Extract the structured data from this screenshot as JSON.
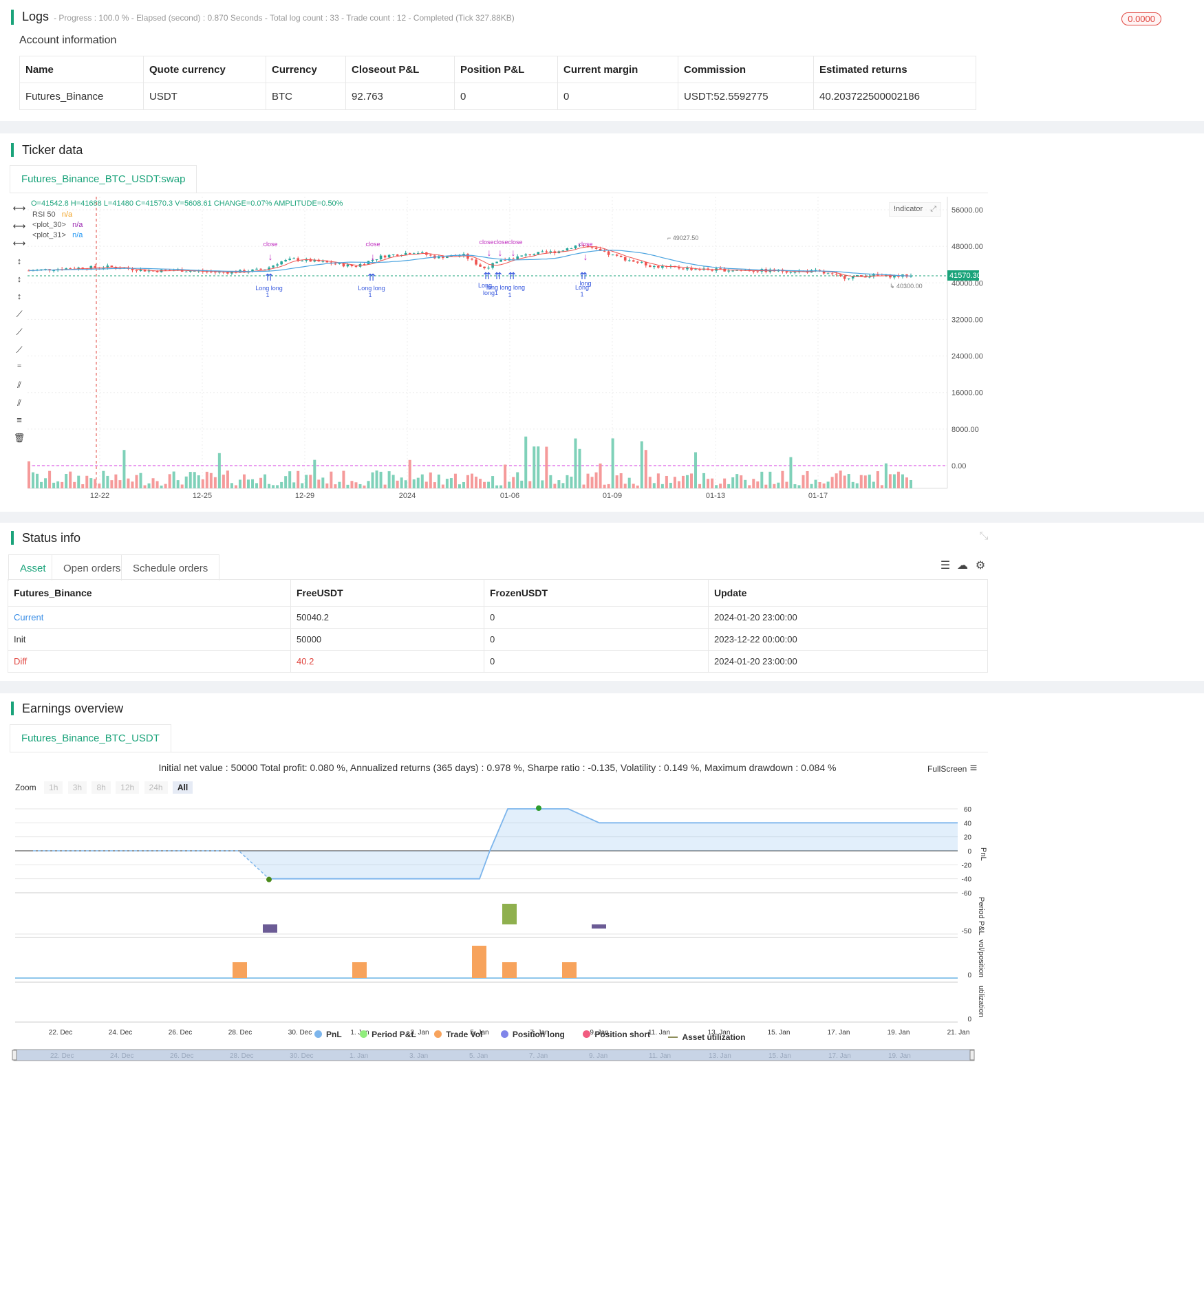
{
  "logs": {
    "title": "Logs",
    "summary": "- Progress : 100.0 % - Elapsed (second) : 0.870  Seconds - Total log count : 33 - Trade count : 12 - Completed (Tick 327.88KB)",
    "badge": "0.0000",
    "account_title": "Account information",
    "columns": [
      "Name",
      "Quote currency",
      "Currency",
      "Closeout P&L",
      "Position P&L",
      "Current margin",
      "Commission",
      "Estimated returns"
    ],
    "row": [
      "Futures_Binance",
      "USDT",
      "BTC",
      "92.763",
      "0",
      "0",
      "USDT:52.5592775",
      "40.203722500002186"
    ]
  },
  "ticker": {
    "title": "Ticker data",
    "tab": "Futures_Binance_BTC_USDT:swap",
    "ohlc": "O=41542.8 H=41688 L=41480 C=41570.3 V=5608.61 CHANGE=0.07% AMPLITUDE=0.50%",
    "legend": [
      {
        "name": "RSI 50",
        "value": "n/a",
        "color": "#f0a020"
      },
      {
        "name": "<plot_30>",
        "value": "n/a",
        "color": "#9c27b0"
      },
      {
        "name": "<plot_31>",
        "value": "n/a",
        "color": "#2196f3"
      }
    ],
    "indicator_label": "Indicator",
    "price_labels": [
      "56000.00",
      "48000.00",
      "40000.00",
      "32000.00",
      "24000.00",
      "16000.00",
      "8000.00",
      "0.00"
    ],
    "last_price": "41570.30",
    "high_label": "49027.50",
    "low_label": "40300.00",
    "x_labels": [
      "12-22",
      "12-25",
      "12-29",
      "2024",
      "01-06",
      "01-09",
      "01-13",
      "01-17"
    ],
    "signals": {
      "close": "close",
      "long": "long",
      "Long": "Long",
      "long1": "long1",
      "one": "1",
      "closeclose": "closeclose",
      "long_long": "long long"
    },
    "toolbar_icons": [
      "crosshair-icon",
      "horizontal-line-icon",
      "horizontal-ray-icon",
      "vertical-line-icon",
      "cross-line-icon",
      "vertical-segment-icon",
      "trend-line-icon",
      "ray-icon",
      "extended-line-icon",
      "price-label-icon",
      "parallel-channel-icon",
      "pitchfork-icon",
      "fib-icon",
      "trash-icon"
    ]
  },
  "status": {
    "title": "Status info",
    "tabs": [
      "Asset",
      "Open orders",
      "Schedule orders"
    ],
    "columns": [
      "Futures_Binance",
      "FreeUSDT",
      "FrozenUSDT",
      "Update"
    ],
    "rows": [
      [
        "Current",
        "50040.2",
        "0",
        "2024-01-20 23:00:00"
      ],
      [
        "Init",
        "50000",
        "0",
        "2023-12-22 00:00:00"
      ],
      [
        "Diff",
        "40.2",
        "0",
        "2024-01-20 23:00:00"
      ]
    ],
    "colors": {
      "current": "#3a8ee6",
      "diff": "#e0443e"
    }
  },
  "earnings": {
    "title": "Earnings overview",
    "tab": "Futures_Binance_BTC_USDT",
    "summary": "Initial net value : 50000 Total profit: 0.080 %, Annualized returns (365 days) : 0.978 %, Sharpe ratio : -0.135, Volatility : 0.149 %, Maximum drawdown : 0.084 %",
    "fullscreen": "FullScreen",
    "zoom_label": "Zoom",
    "zoom_options": [
      "1h",
      "3h",
      "8h",
      "12h",
      "24h",
      "All"
    ],
    "pnl_ticks": [
      "60",
      "40",
      "20",
      "0",
      "-20",
      "-40",
      "-60"
    ],
    "pnl_axis": "PnL",
    "period_axis": "Period P&L",
    "period_tick": "-50",
    "vol_axis": "vol/position",
    "vol_tick": "0",
    "util_axis": "utilization",
    "util_tick": "0",
    "x_labels": [
      "22. Dec",
      "24. Dec",
      "26. Dec",
      "28. Dec",
      "30. Dec",
      "1. Jan",
      "3. Jan",
      "5. Jan",
      "7. Jan",
      "9. Jan",
      "11. Jan",
      "13. Jan",
      "15. Jan",
      "17. Jan",
      "19. Jan",
      "21. Jan"
    ],
    "legend": [
      {
        "name": "PnL",
        "color": "#7cb5ec"
      },
      {
        "name": "Period P&L",
        "color": "#90ed7d"
      },
      {
        "name": "Trade Vol",
        "color": "#f7a35c"
      },
      {
        "name": "Position long",
        "color": "#8085e9"
      },
      {
        "name": "Position short",
        "color": "#f15c80"
      },
      {
        "name": "Asset utilization",
        "color": "#8d8d5a"
      }
    ]
  },
  "chart_data": {
    "type": "line",
    "series": [
      {
        "name": "PnL",
        "x": [
          "21. Dec",
          "28. Dec",
          "29. Dec",
          "4. Jan",
          "5. Jan",
          "6. Jan",
          "7. Jan",
          "8. Jan",
          "9. Jan",
          "21. Jan"
        ],
        "values": [
          0,
          0,
          -40,
          -40,
          0,
          60,
          60,
          60,
          40,
          40
        ]
      }
    ],
    "ylim": [
      -60,
      60
    ]
  }
}
